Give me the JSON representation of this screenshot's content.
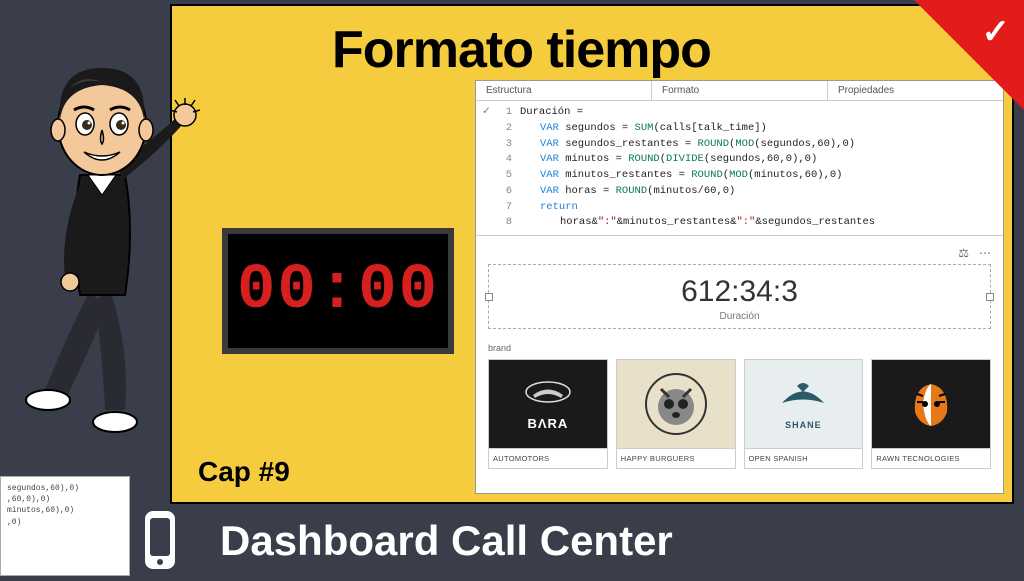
{
  "title": "Formato tiempo",
  "cap": "Cap #9",
  "clock": "00:00",
  "footer": "Dashboard Call Center",
  "tabs": {
    "a": "Estructura",
    "b": "Formato",
    "c": "Propiedades"
  },
  "code": {
    "l1": "Duración =",
    "l2a": "VAR",
    "l2b": " segundos = ",
    "l2c": "SUM",
    "l2d": "(calls[talk_time])",
    "l3a": "VAR",
    "l3b": " segundos_restantes = ",
    "l3c": "ROUND",
    "l3d": "(",
    "l3e": "MOD",
    "l3f": "(segundos,60),0)",
    "l4a": "VAR",
    "l4b": " minutos = ",
    "l4c": "ROUND",
    "l4d": "(",
    "l4e": "DIVIDE",
    "l4f": "(segundos,60,0),0)",
    "l5a": "VAR",
    "l5b": " minutos_restantes = ",
    "l5c": "ROUND",
    "l5d": "(",
    "l5e": "MOD",
    "l5f": "(minutos,60),0)",
    "l6a": "VAR",
    "l6b": " horas = ",
    "l6c": "ROUND",
    "l6d": "(minutos/60,0)",
    "l7": "return",
    "l8a": "horas&",
    "l8b": "\":\"",
    "l8c": "&minutos_restantes&",
    "l8d": "\":\"",
    "l8e": "&segundos_restantes"
  },
  "kpi": {
    "value": "612:34:3",
    "label": "Duración"
  },
  "brand_header": "brand",
  "brands": {
    "b0": "AUTOMOTORS",
    "b1": "HAPPY BURGUERS",
    "b2": "OPEN SPANISH",
    "b3": "RAWN TECNOLOGIES"
  },
  "bara": "BΛRA",
  "shane": "SHANE",
  "snip": {
    "l1": "segundos,60),0)",
    "l2": ",60,0),0)",
    "l3": "minutos,60),0)",
    "l4": ",0)"
  }
}
